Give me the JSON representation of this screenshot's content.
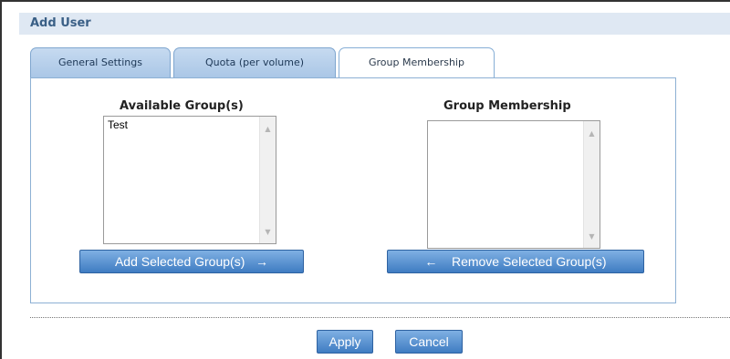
{
  "header": {
    "title": "Add User"
  },
  "tabs": [
    {
      "label": "General Settings",
      "active": false
    },
    {
      "label": "Quota (per volume)",
      "active": false
    },
    {
      "label": "Group Membership",
      "active": true
    }
  ],
  "available": {
    "title": "Available Group(s)",
    "items": [
      "Test"
    ],
    "button_label": "Add Selected Group(s)",
    "button_arrow": "→"
  },
  "membership": {
    "title": "Group Membership",
    "items": [],
    "button_label": "Remove Selected Group(s)",
    "button_arrow": "←"
  },
  "footer": {
    "apply_label": "Apply",
    "cancel_label": "Cancel"
  },
  "icons": {
    "scroll_up": "▲",
    "scroll_down": "▼"
  },
  "colors": {
    "header_bg": "#dfe8f3",
    "header_text": "#3a5f86",
    "button_blue": "#3f7cc2",
    "panel_border": "#8db0d4"
  }
}
